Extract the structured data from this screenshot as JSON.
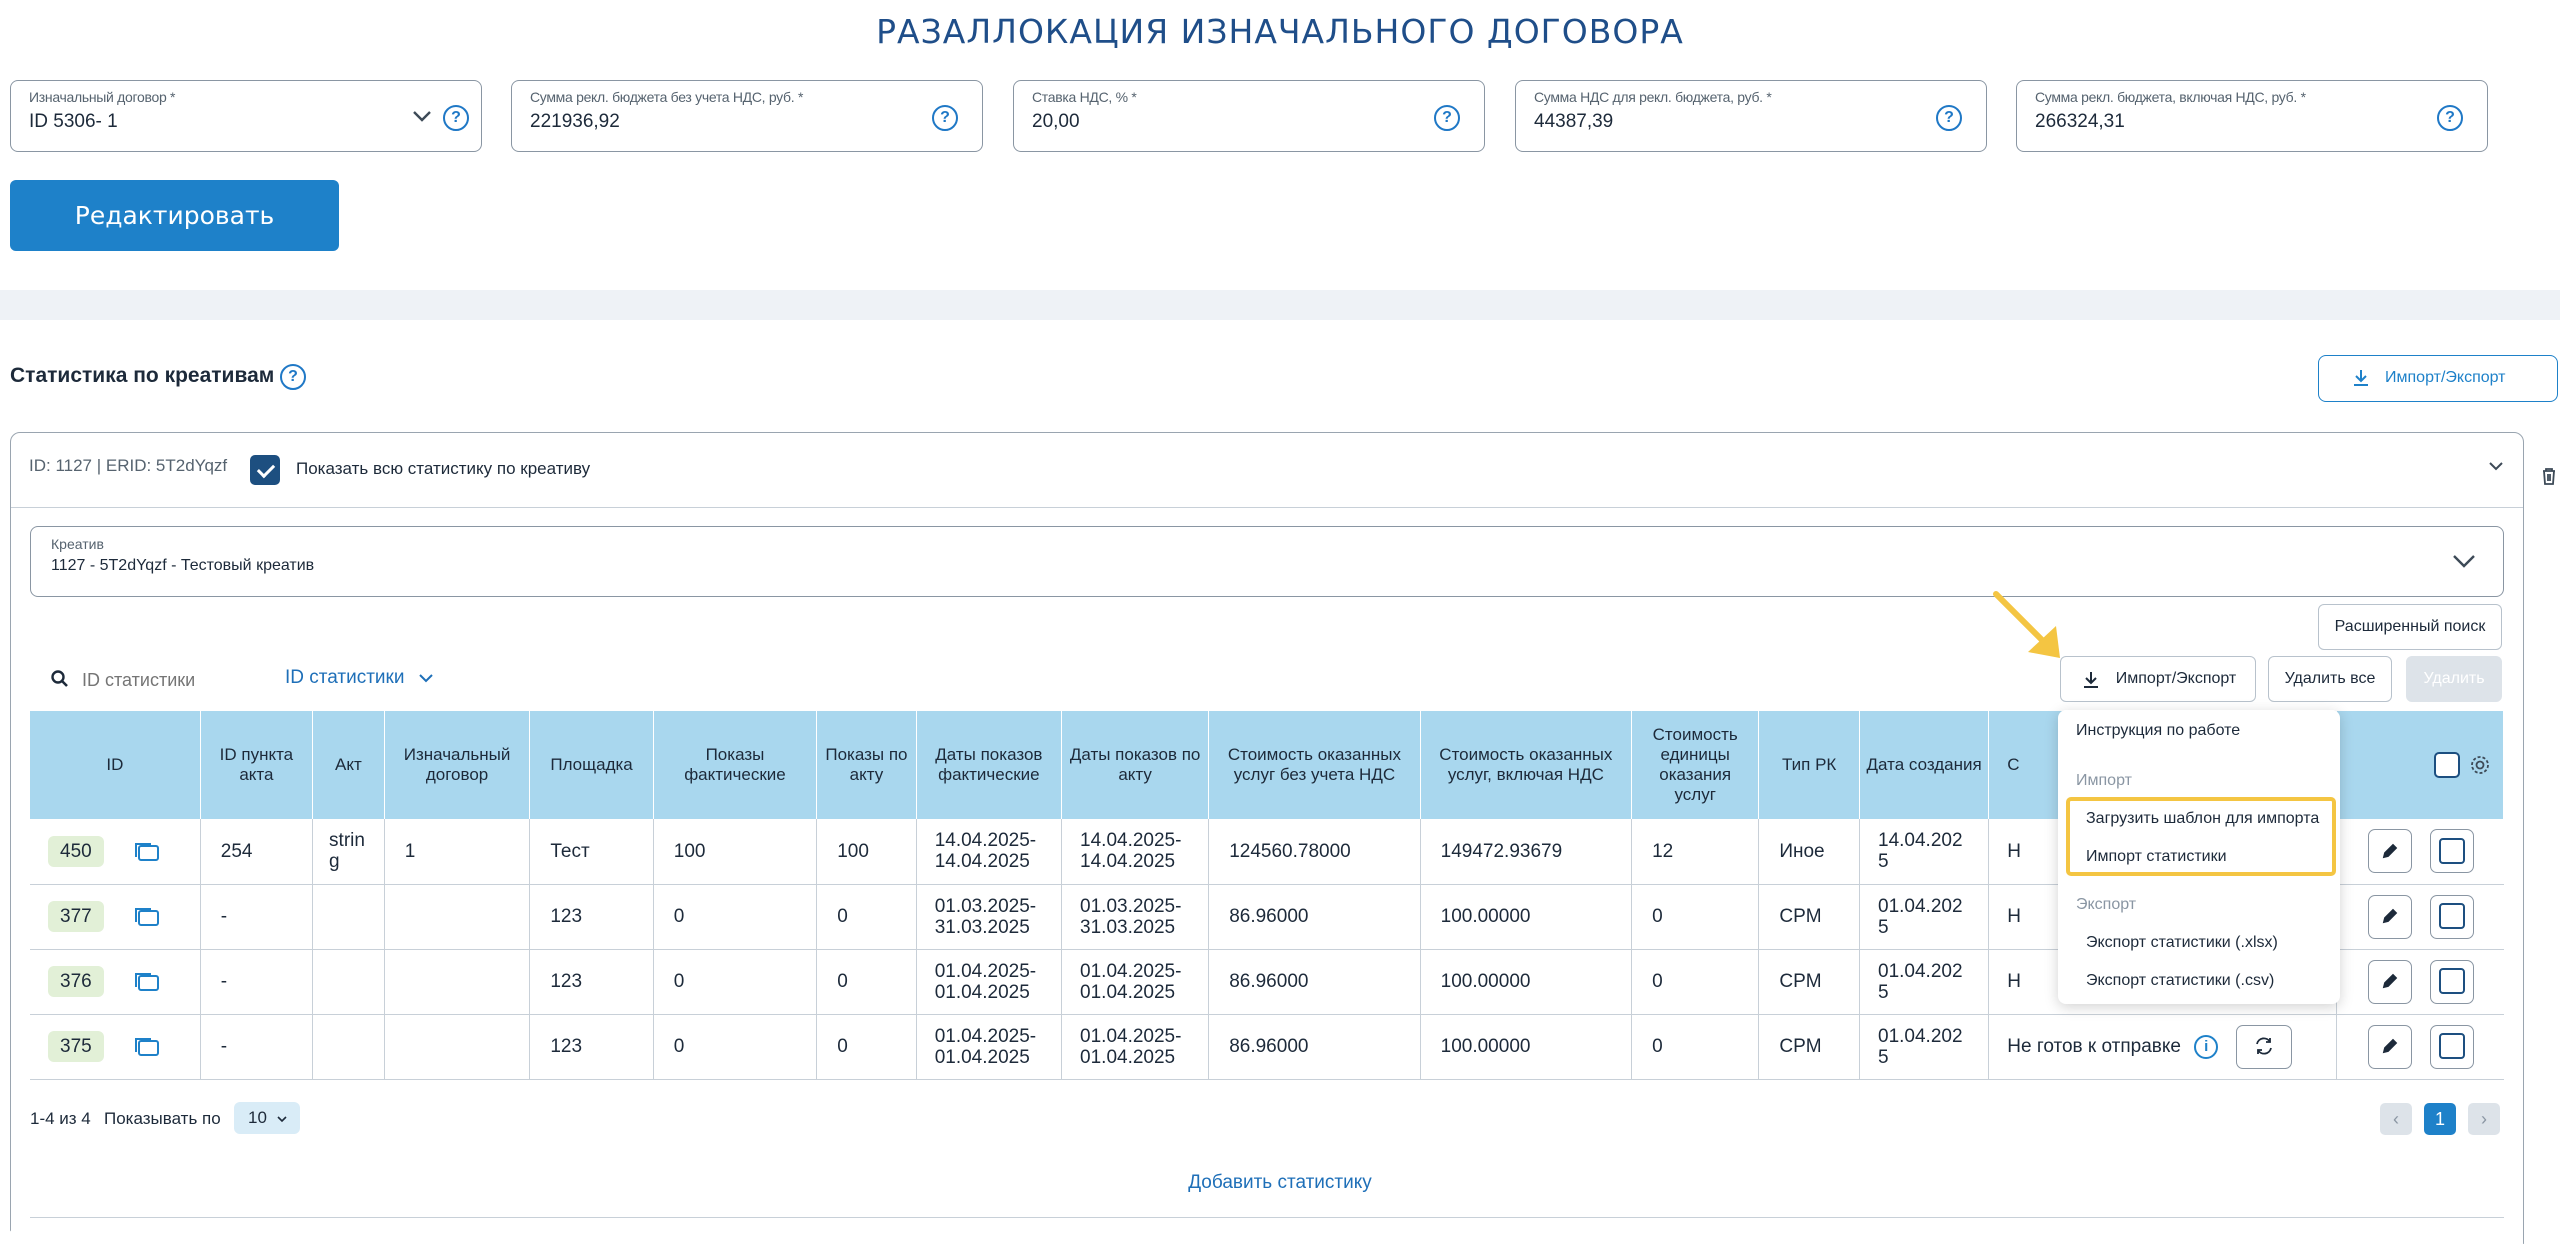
{
  "page_title": "РАЗАЛЛОКАЦИЯ ИЗНАЧАЛЬНОГО ДОГОВОРА",
  "fields": [
    {
      "label": "Изначальный договор *",
      "value": "ID 5306- 1"
    },
    {
      "label": "Сумма рекл. бюджета без учета НДС, руб. *",
      "value": "221936,92"
    },
    {
      "label": "Ставка НДС, % *",
      "value": "20,00"
    },
    {
      "label": "Сумма НДС для рекл. бюджета, руб. *",
      "value": "44387,39"
    },
    {
      "label": "Сумма рекл. бюджета, включая НДС, руб. *",
      "value": "266324,31"
    }
  ],
  "edit_button": "Редактировать",
  "section": {
    "title": "Статистика по креативам",
    "import_export": "Импорт/Экспорт"
  },
  "card": {
    "header": "ID: 1127 | ERID: 5T2dYqzf",
    "show_all_label": "Показать всю статистику по креативу",
    "creative_label": "Креатив",
    "creative_value": "1127 - 5T2dYqzf - Тестовый креатив",
    "advanced_search": "Расширенный поиск",
    "search_placeholder": "ID статистики",
    "search_type": "ID статистики",
    "import_export": "Импорт/Экспорт",
    "delete_all": "Удалить все",
    "delete": "Удалить",
    "add_stat": "Добавить статистику"
  },
  "table": {
    "headers": [
      "ID",
      "ID пункта акта",
      "Акт",
      "Изначальный договор",
      "Площадка",
      "Показы фактические",
      "Показы по акту",
      "Даты показов фактические",
      "Даты показов по акту",
      "Стоимость оказанных услуг без учета НДС",
      "Стоимость оказанных услуг, включая НДС",
      "Стоимость единицы оказания услуг",
      "Тип РК",
      "Дата создания",
      "С"
    ],
    "rows": [
      {
        "id": "450",
        "act_item": "254",
        "act": "strin g",
        "contract": "1",
        "platform": "Тест",
        "shows_fact": "100",
        "shows_act": "100",
        "dates_fact": "14.04.2025- 14.04.2025",
        "dates_act": "14.04.2025- 14.04.2025",
        "cost_no_vat": "124560.78000",
        "cost_vat": "149472.93679",
        "unit_cost": "12",
        "type": "Иное",
        "created": "14.04.202 5",
        "status": "Н"
      },
      {
        "id": "377",
        "act_item": "-",
        "act": "",
        "contract": "",
        "platform": "123",
        "shows_fact": "0",
        "shows_act": "0",
        "dates_fact": "01.03.2025- 31.03.2025",
        "dates_act": "01.03.2025- 31.03.2025",
        "cost_no_vat": "86.96000",
        "cost_vat": "100.00000",
        "unit_cost": "0",
        "type": "CPM",
        "created": "01.04.202 5",
        "status": "Н"
      },
      {
        "id": "376",
        "act_item": "-",
        "act": "",
        "contract": "",
        "platform": "123",
        "shows_fact": "0",
        "shows_act": "0",
        "dates_fact": "01.04.2025- 01.04.2025",
        "dates_act": "01.04.2025- 01.04.2025",
        "cost_no_vat": "86.96000",
        "cost_vat": "100.00000",
        "unit_cost": "0",
        "type": "CPM",
        "created": "01.04.202 5",
        "status": "Н"
      },
      {
        "id": "375",
        "act_item": "-",
        "act": "",
        "contract": "",
        "platform": "123",
        "shows_fact": "0",
        "shows_act": "0",
        "dates_fact": "01.04.2025- 01.04.2025",
        "dates_act": "01.04.2025- 01.04.2025",
        "cost_no_vat": "86.96000",
        "cost_vat": "100.00000",
        "unit_cost": "0",
        "type": "CPM",
        "created": "01.04.202 5",
        "status": "Не готов к отправке"
      }
    ]
  },
  "menu": {
    "instructions": "Инструкция по работе",
    "import_group": "Импорт",
    "download_template": "Загрузить шаблон для импорта",
    "import_stats": "Импорт статистики",
    "export_group": "Экспорт",
    "export_xlsx": "Экспорт статистики (.xlsx)",
    "export_csv": "Экспорт статистики (.csv)"
  },
  "pagination": {
    "range": "1-4 из 4",
    "per_page_label": "Показывать по",
    "per_page": "10",
    "current_page": "1"
  },
  "colors": {
    "accent": "#1e81c9",
    "title": "#1f4e89",
    "header_bg": "#a9d7ee",
    "highlight": "#f4c542"
  }
}
